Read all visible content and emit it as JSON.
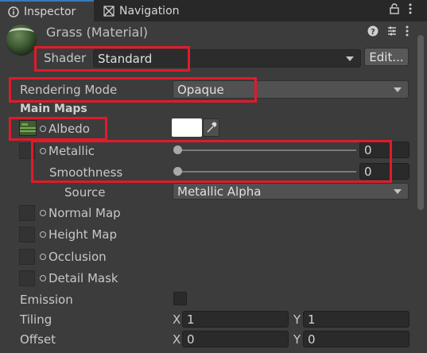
{
  "tabs": [
    {
      "label": "Inspector",
      "icon": "info-icon"
    },
    {
      "label": "Navigation",
      "icon": "navigation-icon"
    }
  ],
  "header": {
    "title": "Grass (Material)"
  },
  "shader": {
    "label": "Shader",
    "value": "Standard",
    "edit_label": "Edit..."
  },
  "rendering": {
    "label": "Rendering Mode",
    "value": "Opaque"
  },
  "main_maps": {
    "heading": "Main Maps"
  },
  "albedo": {
    "label": "Albedo",
    "color": "#ffffff"
  },
  "metallic": {
    "label": "Metallic",
    "value": "0",
    "fraction": 0
  },
  "smoothness": {
    "label": "Smoothness",
    "value": "0",
    "fraction": 0
  },
  "source": {
    "label": "Source",
    "value": "Metallic Alpha"
  },
  "maps": [
    {
      "label": "Normal Map"
    },
    {
      "label": "Height Map"
    },
    {
      "label": "Occlusion"
    },
    {
      "label": "Detail Mask"
    }
  ],
  "emission": {
    "label": "Emission",
    "checked": false
  },
  "tiling": {
    "label": "Tiling",
    "x_label": "X",
    "x": "1",
    "y_label": "Y",
    "y": "1"
  },
  "offset": {
    "label": "Offset",
    "x_label": "X",
    "x": "0",
    "y_label": "Y",
    "y": "0"
  },
  "colors": {
    "highlight": "#e11a2a",
    "accent": "#3a79bb"
  }
}
